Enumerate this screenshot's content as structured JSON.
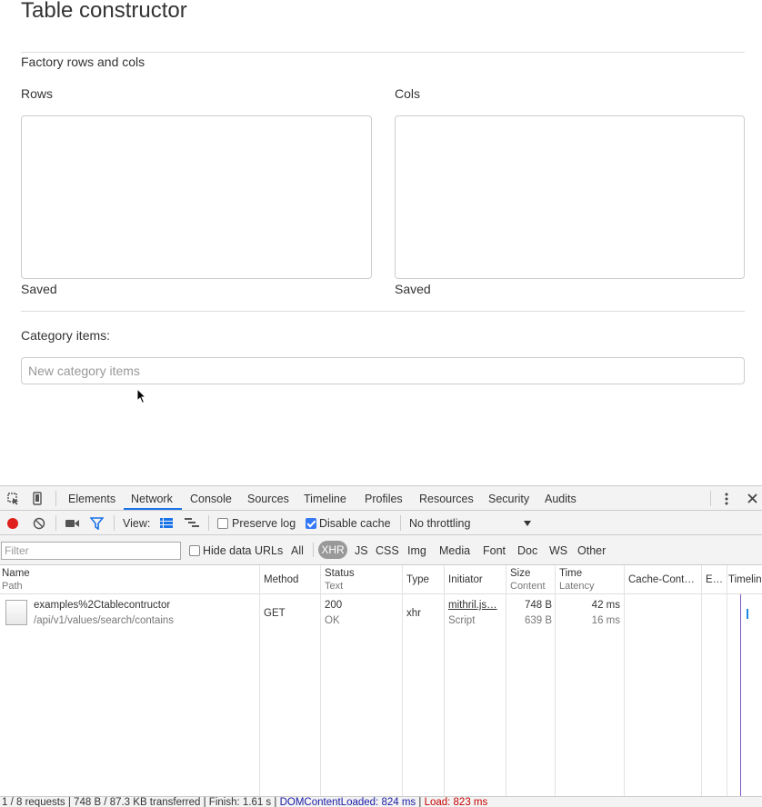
{
  "page": {
    "title": "Table constructor",
    "subtitle": "Factory rows and cols",
    "rows_label": "Rows",
    "cols_label": "Cols",
    "rows_status": "Saved",
    "cols_status": "Saved",
    "category_label": "Category items:",
    "category_placeholder": "New category items"
  },
  "devtools": {
    "tabs": [
      "Elements",
      "Network",
      "Console",
      "Sources",
      "Timeline",
      "Profiles",
      "Resources",
      "Security",
      "Audits"
    ],
    "active_tab": "Network",
    "toolbar": {
      "view_label": "View:",
      "preserve_log": "Preserve log",
      "preserve_log_checked": false,
      "disable_cache": "Disable cache",
      "disable_cache_checked": true,
      "throttling": "No throttling"
    },
    "filter": {
      "placeholder": "Filter",
      "hide_data_urls": "Hide data URLs",
      "types": [
        "All",
        "XHR",
        "JS",
        "CSS",
        "Img",
        "Media",
        "Font",
        "Doc",
        "WS",
        "Other"
      ],
      "active_type": "XHR"
    },
    "columns": [
      {
        "title": "Name",
        "sub": "Path"
      },
      {
        "title": "Method",
        "sub": ""
      },
      {
        "title": "Status",
        "sub": "Text"
      },
      {
        "title": "Type",
        "sub": ""
      },
      {
        "title": "Initiator",
        "sub": ""
      },
      {
        "title": "Size",
        "sub": "Content"
      },
      {
        "title": "Time",
        "sub": "Latency"
      },
      {
        "title": "Cache-Cont…",
        "sub": ""
      },
      {
        "title": "E…",
        "sub": ""
      },
      {
        "title": "Timeline",
        "sub": ""
      }
    ],
    "rows": [
      {
        "name": "examples%2Ctablecontructor",
        "path": "/api/v1/values/search/contains",
        "method": "GET",
        "status": "200",
        "status_text": "OK",
        "type": "xhr",
        "initiator": "mithril.js…",
        "initiator_sub": "Script",
        "size": "748 B",
        "content": "639 B",
        "time": "42 ms",
        "latency": "16 ms"
      }
    ],
    "status_bar": {
      "summary": "1 / 8 requests | 748 B / 87.3 KB transferred | Finish: 1.61 s | ",
      "dom": "DOMContentLoaded: 824 ms",
      "divider": " | ",
      "load": "Load: 823 ms"
    },
    "colors": {
      "record": "#e0201c",
      "accent": "#1a73e8",
      "timeline_line": "#7e57c2",
      "timeline_bar": "#1e88e5"
    }
  }
}
